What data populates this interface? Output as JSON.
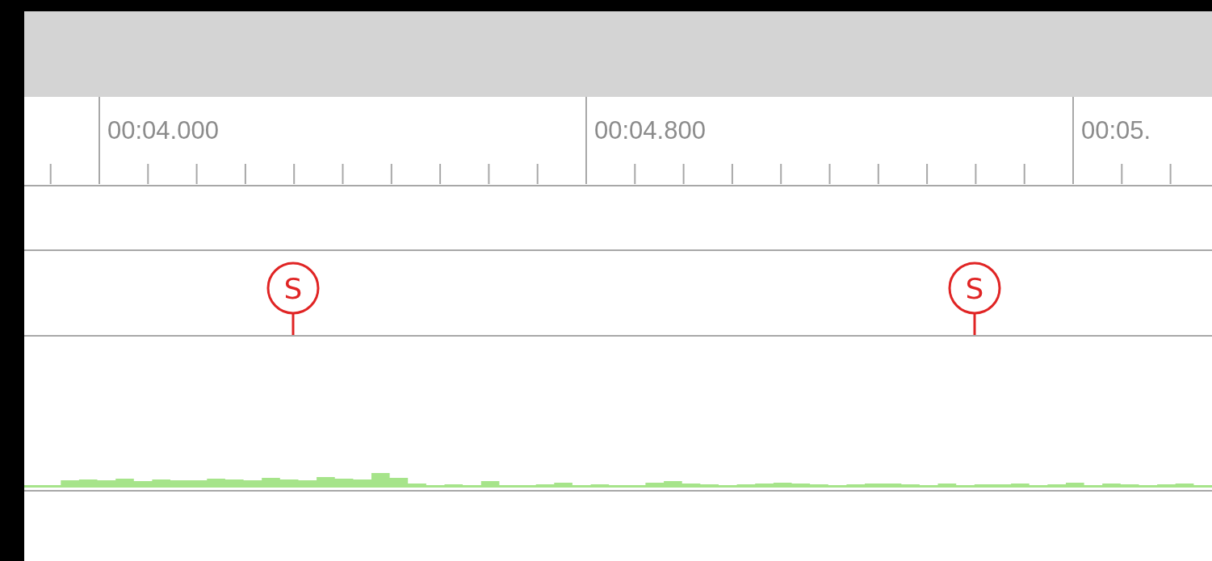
{
  "ruler": {
    "labels": [
      "00:04.000",
      "00:04.800",
      "00:05."
    ]
  },
  "markers": [
    {
      "label": "S"
    },
    {
      "label": "S"
    }
  ]
}
